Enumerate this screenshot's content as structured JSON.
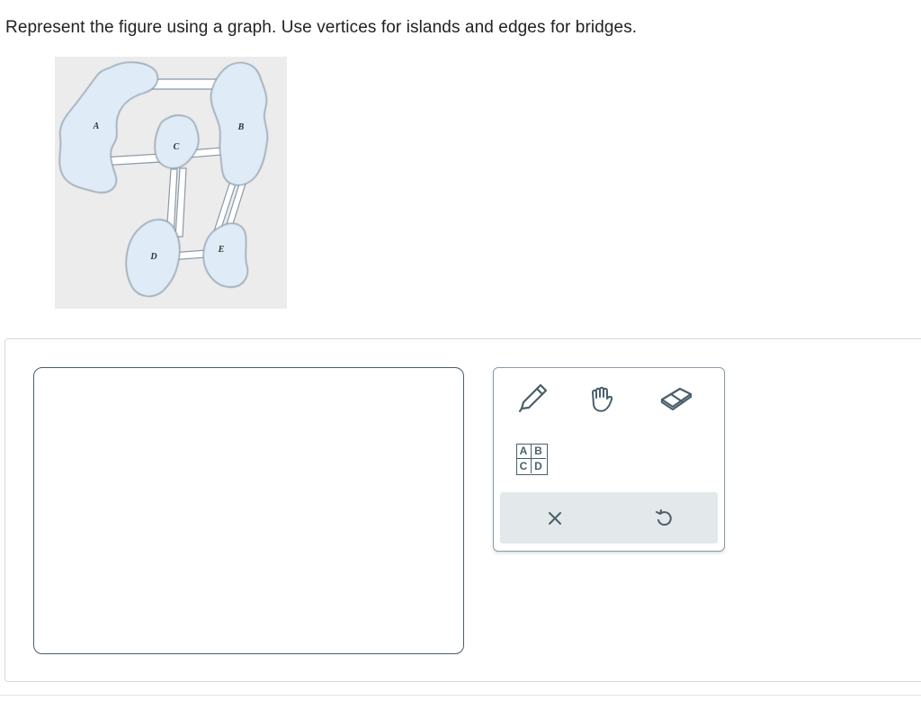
{
  "question": {
    "prompt": "Represent the figure using a graph. Use vertices for islands and edges for bridges."
  },
  "figure": {
    "islands": [
      {
        "label": "A"
      },
      {
        "label": "B"
      },
      {
        "label": "C"
      },
      {
        "label": "D"
      },
      {
        "label": "E"
      }
    ],
    "colors": {
      "island_fill": "#dfecf7",
      "island_stroke": "#8a9aa8",
      "background": "#ececec"
    }
  },
  "toolbox": {
    "tools": [
      {
        "name": "pencil-tool",
        "icon": "pencil-icon"
      },
      {
        "name": "hand-tool",
        "icon": "hand-icon"
      },
      {
        "name": "eraser-tool",
        "icon": "eraser-icon"
      },
      {
        "name": "label-tool",
        "icon": "label-grid-icon"
      }
    ],
    "label_letters": [
      "A",
      "B",
      "C",
      "D"
    ],
    "actions": [
      {
        "name": "clear",
        "icon": "close-icon"
      },
      {
        "name": "undo",
        "icon": "undo-icon"
      }
    ],
    "colors": {
      "icon": "#4a5f6a",
      "action_bar": "#e3e8ea"
    }
  }
}
